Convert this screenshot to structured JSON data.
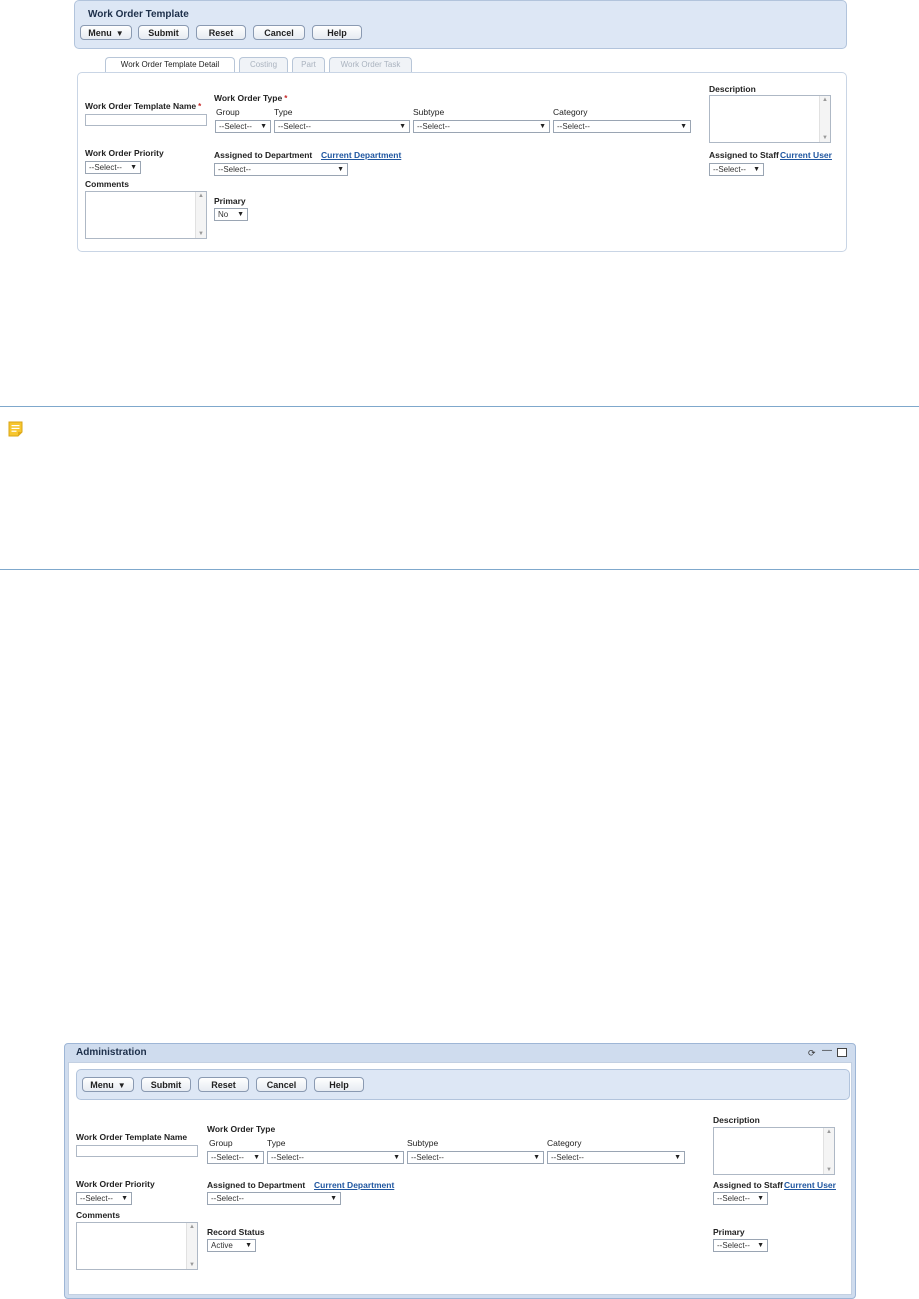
{
  "top_form": {
    "title": "Work Order Template",
    "toolbar": {
      "menu": "Menu",
      "submit": "Submit",
      "reset": "Reset",
      "cancel": "Cancel",
      "help": "Help"
    },
    "tabs": [
      "Work Order Template Detail",
      "Costing",
      "Part",
      "Work Order Task"
    ],
    "fields": {
      "template_name_label": "Work Order Template Name",
      "required_mark": "*",
      "work_order_type_label": "Work Order Type",
      "group_label": "Group",
      "type_label": "Type",
      "subtype_label": "Subtype",
      "category_label": "Category",
      "select_placeholder": "--Select--",
      "description_label": "Description",
      "priority_label": "Work Order Priority",
      "assigned_dept_label": "Assigned to Department",
      "current_department_link": "Current Department",
      "assigned_staff_label": "Assigned to Staff",
      "current_user_link": "Current User",
      "comments_label": "Comments",
      "primary_label": "Primary",
      "primary_value": "No"
    }
  },
  "note": {
    "icon": "note-icon"
  },
  "bottom_form": {
    "window_title": "Administration",
    "window_icons": [
      "refresh-icon",
      "minimize-icon",
      "maximize-icon"
    ],
    "toolbar": {
      "menu": "Menu",
      "submit": "Submit",
      "reset": "Reset",
      "cancel": "Cancel",
      "help": "Help"
    },
    "fields": {
      "template_name_label": "Work Order Template Name",
      "work_order_type_label": "Work Order Type",
      "group_label": "Group",
      "type_label": "Type",
      "subtype_label": "Subtype",
      "category_label": "Category",
      "select_placeholder": "--Select--",
      "description_label": "Description",
      "priority_label": "Work Order Priority",
      "assigned_dept_label": "Assigned to Department",
      "current_department_link": "Current Department",
      "assigned_staff_label": "Assigned to Staff",
      "current_user_link": "Current User",
      "comments_label": "Comments",
      "record_status_label": "Record Status",
      "record_status_value": "Active",
      "primary_label": "Primary"
    }
  }
}
